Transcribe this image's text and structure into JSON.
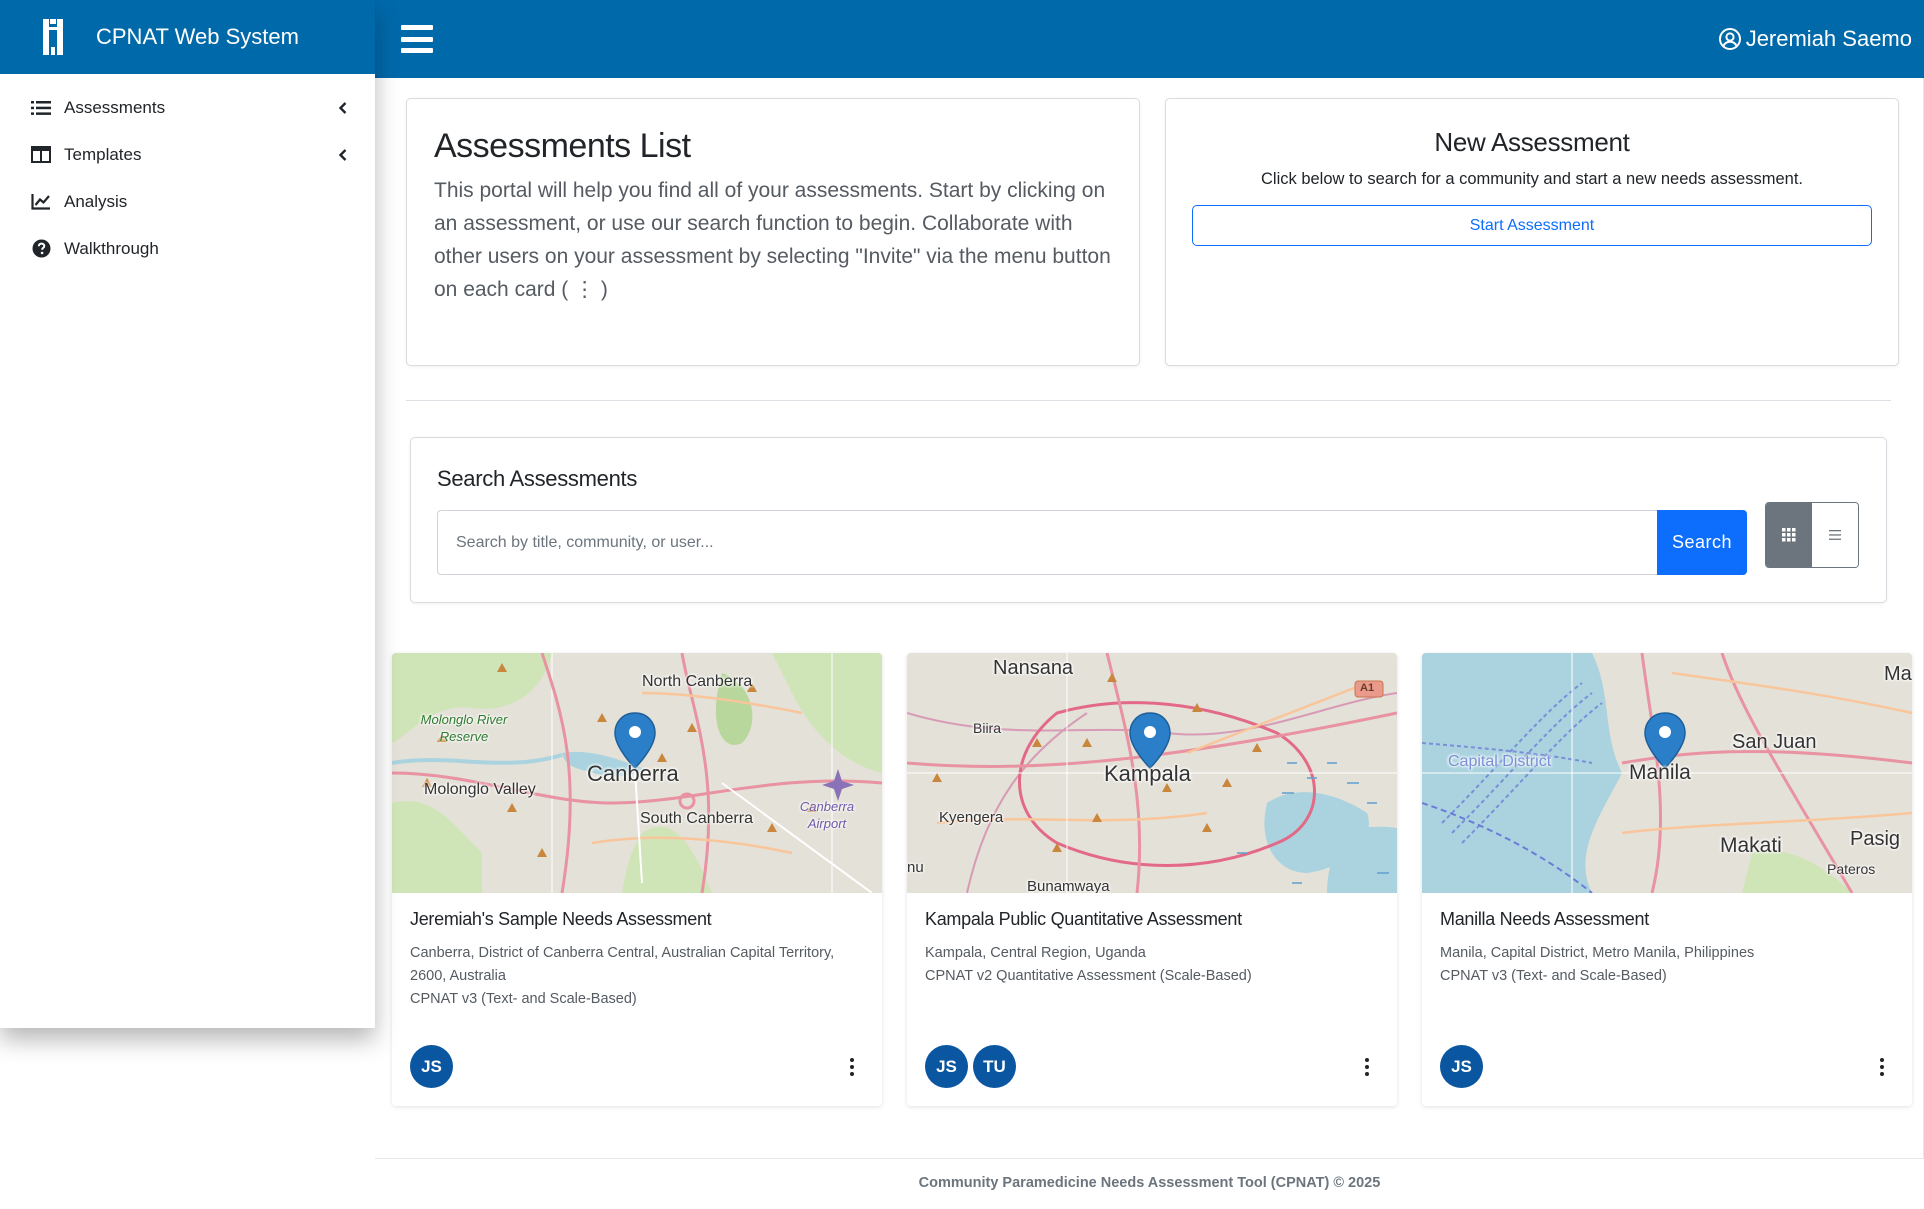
{
  "sidebar": {
    "brand": {
      "title": "CPNAT Web System",
      "logo_icon": "cpnat-logo"
    },
    "items": [
      {
        "label": "Assessments",
        "icon": "list-icon",
        "has_chevron": true
      },
      {
        "label": "Templates",
        "icon": "table-icon",
        "has_chevron": true
      },
      {
        "label": "Analysis",
        "icon": "chart-line-icon",
        "has_chevron": false
      },
      {
        "label": "Walkthrough",
        "icon": "question-circle-icon",
        "has_chevron": false
      }
    ]
  },
  "topbar": {
    "user_name": "Jeremiah Saemo",
    "accent_color": "#0069aa"
  },
  "intro": {
    "title": "Assessments List",
    "text": "This portal will help you find all of your assessments. Start by clicking on an assessment, or use our search function to begin. Collaborate with other users on your assessment by selecting \"Invite\" via the menu button on each card ( ⋮ )"
  },
  "new_assessment": {
    "title": "New Assessment",
    "text": "Click below to search for a community and start a new needs assessment.",
    "button_label": "Start Assessment"
  },
  "search": {
    "title": "Search Assessments",
    "placeholder": "Search by title, community, or user...",
    "value": "",
    "button_label": "Search",
    "view_mode": "grid"
  },
  "assessments": [
    {
      "title": "Jeremiah's Sample Needs Assessment",
      "location": "Canberra, District of Canberra Central, Australian Capital Territory, 2600, Australia",
      "type": "CPNAT v3 (Text- and Scale-Based)",
      "users": [
        "JS"
      ],
      "map_labels": [
        "North Canberra",
        "Molonglo River Reserve",
        "Molonglo Valley",
        "Canberra",
        "South Canberra",
        "Canberra Airport"
      ]
    },
    {
      "title": "Kampala Public Quantitative Assessment",
      "location": "Kampala, Central Region, Uganda",
      "type": "CPNAT v2 Quantitative Assessment (Scale-Based)",
      "users": [
        "JS",
        "TU"
      ],
      "map_labels": [
        "Nansana",
        "Biira",
        "Kampala",
        "Kyengera",
        "Bunamwaya",
        "A1",
        "nu"
      ]
    },
    {
      "title": "Manilla Needs Assessment",
      "location": "Manila, Capital District, Metro Manila, Philippines",
      "type": "CPNAT v3 (Text- and Scale-Based)",
      "users": [
        "JS"
      ],
      "map_labels": [
        "Ma",
        "San Juan",
        "Capital District",
        "Manila",
        "Makati",
        "Pasig",
        "Pateros"
      ]
    }
  ],
  "footer": {
    "text": "Community Paramedicine Needs Assessment Tool (CPNAT) © 2025"
  }
}
